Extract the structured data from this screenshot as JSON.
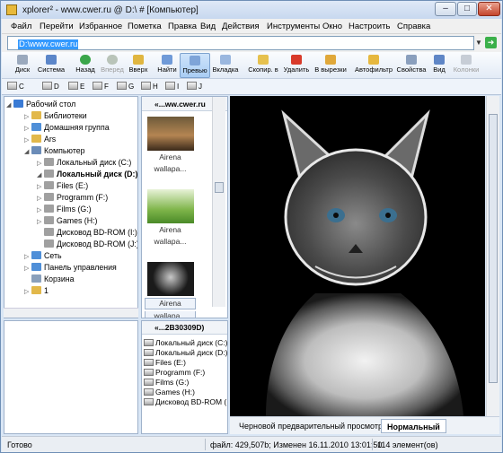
{
  "window": {
    "title": "xplorer² - www.cwer.ru @ D:\\ # [Компьютер]"
  },
  "menu": [
    "Файл",
    "Перейти",
    "Избранное",
    "Пометка",
    "Правка",
    "Вид",
    "Действия",
    "Инструменты",
    "Окно",
    "Настроить",
    "Справка"
  ],
  "address": {
    "value": "D:\\www.cwer.ru"
  },
  "toolbar": {
    "disk": "Диск",
    "system": "Система",
    "back": "Назад",
    "forward": "Вперед",
    "up": "Вверх",
    "find": "Найти",
    "preview": "Превью",
    "tab": "Вкладка",
    "copy_to": "Скопир. в",
    "delete": "Удалить",
    "to_clipboard": "В вырезки",
    "autofilter": "Автофильтр",
    "properties": "Свойства",
    "view": "Вид",
    "columns": "Колонки"
  },
  "drives": [
    "C",
    "D",
    "E",
    "F",
    "G",
    "H",
    "I",
    "J"
  ],
  "tree": [
    {
      "label": "Рабочий стол",
      "color": "#3a7bd5"
    },
    {
      "label": "Библиотеки",
      "color": "#e2b84a"
    },
    {
      "label": "Домашняя группа",
      "color": "#4f8fd8"
    },
    {
      "label": "Ars",
      "color": "#e2b84a"
    },
    {
      "label": "Компьютер",
      "color": "#6b8cb8"
    },
    {
      "label": "Локальный диск (C:)",
      "color": "#a0a0a0"
    },
    {
      "label": "Локальный диск (D:)",
      "color": "#a0a0a0"
    },
    {
      "label": "Files (E:)",
      "color": "#a0a0a0"
    },
    {
      "label": "Programm (F:)",
      "color": "#a0a0a0"
    },
    {
      "label": "Films (G:)",
      "color": "#a0a0a0"
    },
    {
      "label": "Games (H:)",
      "color": "#a0a0a0"
    },
    {
      "label": "Дисковод BD-ROM (I:)",
      "color": "#a0a0a0"
    },
    {
      "label": "Дисковод BD-ROM (J:)",
      "color": "#a0a0a0"
    },
    {
      "label": "Сеть",
      "color": "#4f8fd8"
    },
    {
      "label": "Панель управления",
      "color": "#4f8fd8"
    },
    {
      "label": "Корзина",
      "color": "#8aa0bb"
    },
    {
      "label": "1",
      "color": "#e2b84a"
    }
  ],
  "thumbs": {
    "header": "«...ww.cwer.ru",
    "items": [
      {
        "caption1": "Airena",
        "caption2": "wallapa..."
      },
      {
        "caption1": "Airena",
        "caption2": "wallapa..."
      },
      {
        "caption1": "Airena",
        "caption2": "wallapa..."
      }
    ]
  },
  "drive_pane": {
    "header": "«...2B30309D)",
    "items": [
      "Локальный диск (C:)",
      "Локальный диск (D:)",
      "Files (E:)",
      "Programm (F:)",
      "Films (G:)",
      "Games (H:)",
      "Дисковод BD-ROM (I:)"
    ]
  },
  "preview_tabs": {
    "tab1": "Черновой предварительный просмотр",
    "tab2": "Нормальный"
  },
  "status": {
    "ready": "Готово",
    "file_info": "файл: 429,507b; Изменен 16.11.2010 13:01:50",
    "count": "114 элемент(ов)"
  }
}
